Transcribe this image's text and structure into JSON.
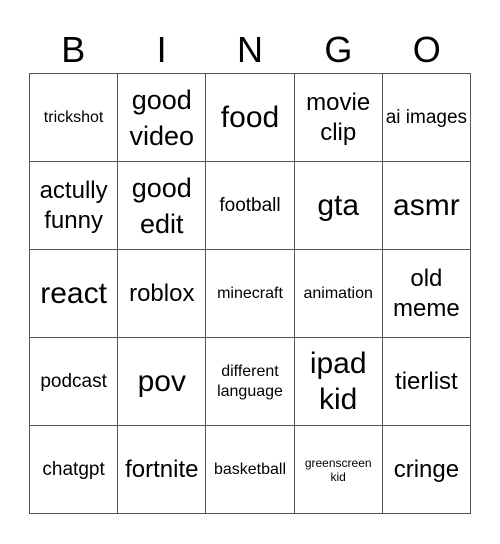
{
  "header": [
    "B",
    "I",
    "N",
    "G",
    "O"
  ],
  "cells": [
    {
      "text": "trickshot",
      "size": "s-s"
    },
    {
      "text": "good video",
      "size": "s-xl"
    },
    {
      "text": "food",
      "size": "s-xxl"
    },
    {
      "text": "movie clip",
      "size": "s-l"
    },
    {
      "text": "ai images",
      "size": "s-m"
    },
    {
      "text": "actully funny",
      "size": "s-l"
    },
    {
      "text": "good edit",
      "size": "s-xl"
    },
    {
      "text": "football",
      "size": "s-m"
    },
    {
      "text": "gta",
      "size": "s-xxl"
    },
    {
      "text": "asmr",
      "size": "s-xxl"
    },
    {
      "text": "react",
      "size": "s-xxl"
    },
    {
      "text": "roblox",
      "size": "s-l"
    },
    {
      "text": "minecraft",
      "size": "s-s"
    },
    {
      "text": "animation",
      "size": "s-s"
    },
    {
      "text": "old meme",
      "size": "s-l"
    },
    {
      "text": "podcast",
      "size": "s-m"
    },
    {
      "text": "pov",
      "size": "s-xxl"
    },
    {
      "text": "different language",
      "size": "s-s"
    },
    {
      "text": "ipad kid",
      "size": "s-xxl"
    },
    {
      "text": "tierlist",
      "size": "s-l"
    },
    {
      "text": "chatgpt",
      "size": "s-m"
    },
    {
      "text": "fortnite",
      "size": "s-l"
    },
    {
      "text": "basketball",
      "size": "s-s"
    },
    {
      "text": "greenscreen kid",
      "size": "s-xs"
    },
    {
      "text": "cringe",
      "size": "s-l"
    }
  ]
}
